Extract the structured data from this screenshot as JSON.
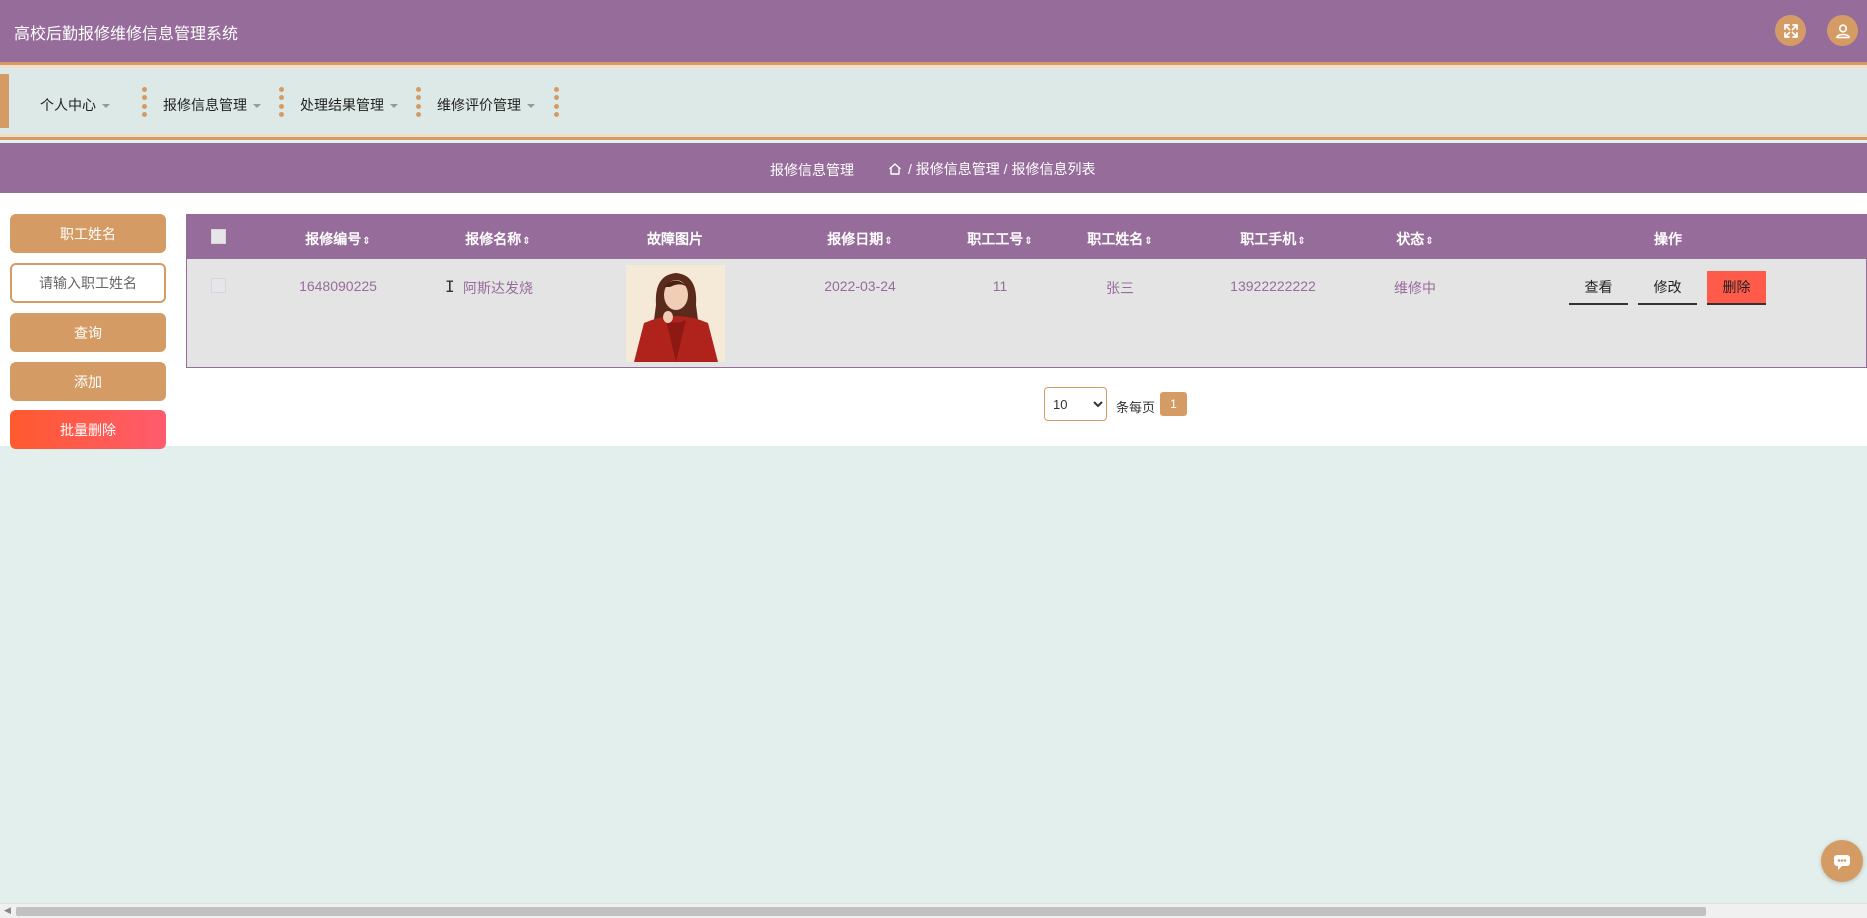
{
  "app": {
    "title": "高校后勤报修维修信息管理系统"
  },
  "header": {
    "icons": [
      "fullscreen-icon",
      "user-icon"
    ]
  },
  "nav": {
    "items": [
      {
        "label": "个人中心"
      },
      {
        "label": "报修信息管理"
      },
      {
        "label": "处理结果管理"
      },
      {
        "label": "维修评价管理"
      }
    ]
  },
  "breadcrumb": {
    "title": "报修信息管理",
    "path": "/ 报修信息管理 / 报修信息列表"
  },
  "sidebar": {
    "search_label": "职工姓名",
    "search_placeholder": "请输入职工姓名",
    "query_label": "查询",
    "add_label": "添加",
    "batch_delete_label": "批量删除"
  },
  "table": {
    "columns": [
      "报修编号",
      "报修名称",
      "故障图片",
      "报修日期",
      "职工工号",
      "职工姓名",
      "职工手机",
      "状态",
      "操作"
    ],
    "sort_glyph": "⇕",
    "rows": [
      {
        "id": "1648090225",
        "name": "阿斯达发烧",
        "date": "2022-03-24",
        "staff_no": "11",
        "staff_name": "张三",
        "phone": "13922222222",
        "status": "维修中"
      }
    ],
    "actions": {
      "view": "查看",
      "edit": "修改",
      "delete": "删除"
    }
  },
  "pager": {
    "page_size": "10",
    "page_size_options": [
      "10"
    ],
    "per_page_text": "条每页",
    "current_page": "1"
  },
  "colors": {
    "primary_purple": "#966c9b",
    "accent_orange": "#d49c64",
    "danger_red": "#ff5a4a",
    "background": "#e3efec"
  }
}
